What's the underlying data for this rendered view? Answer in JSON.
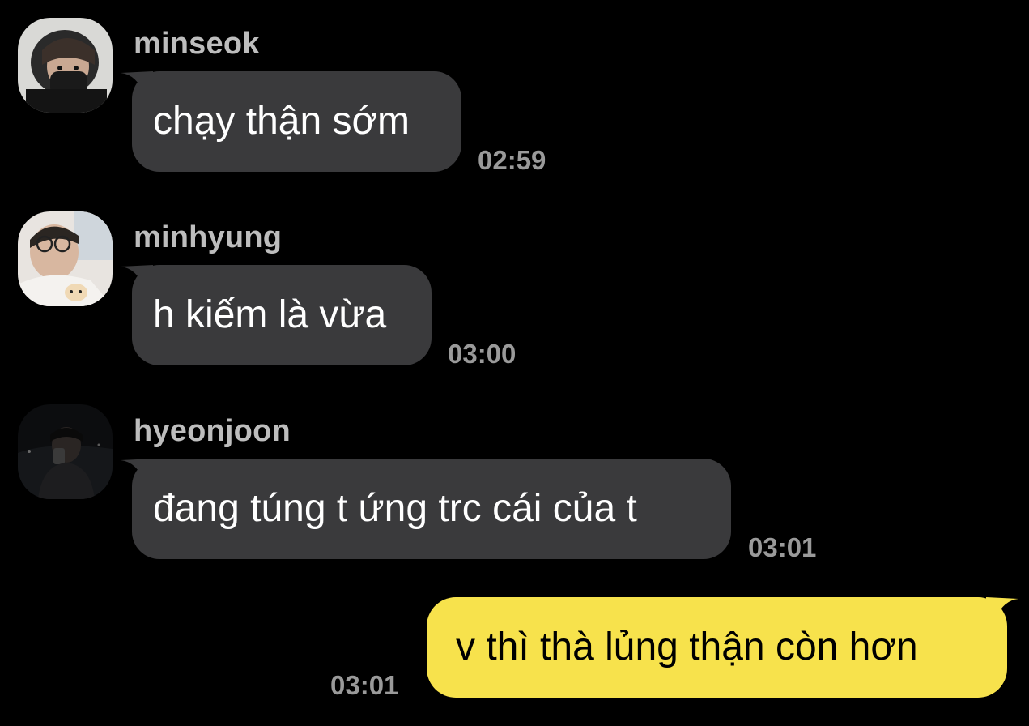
{
  "messages": [
    {
      "sender": "minseok",
      "text": "chạy thận sớm",
      "time": "02:59",
      "avatar": "avatar-minseok"
    },
    {
      "sender": "minhyung",
      "text": "h kiếm là vừa",
      "time": "03:00",
      "avatar": "avatar-minhyung"
    },
    {
      "sender": "hyeonjoon",
      "text": "đang túng t ứng trc cái của t",
      "time": "03:01",
      "avatar": "avatar-hyeonjoon"
    }
  ],
  "my_message": {
    "text": "v thì thà lủng thận còn hơn",
    "time": "03:01"
  },
  "colors": {
    "background": "#000000",
    "incoming_bubble": "#3a3a3c",
    "outgoing_bubble": "#f7e24c",
    "sender_name": "#bdbdbd",
    "timestamp": "#9a9a9a"
  }
}
